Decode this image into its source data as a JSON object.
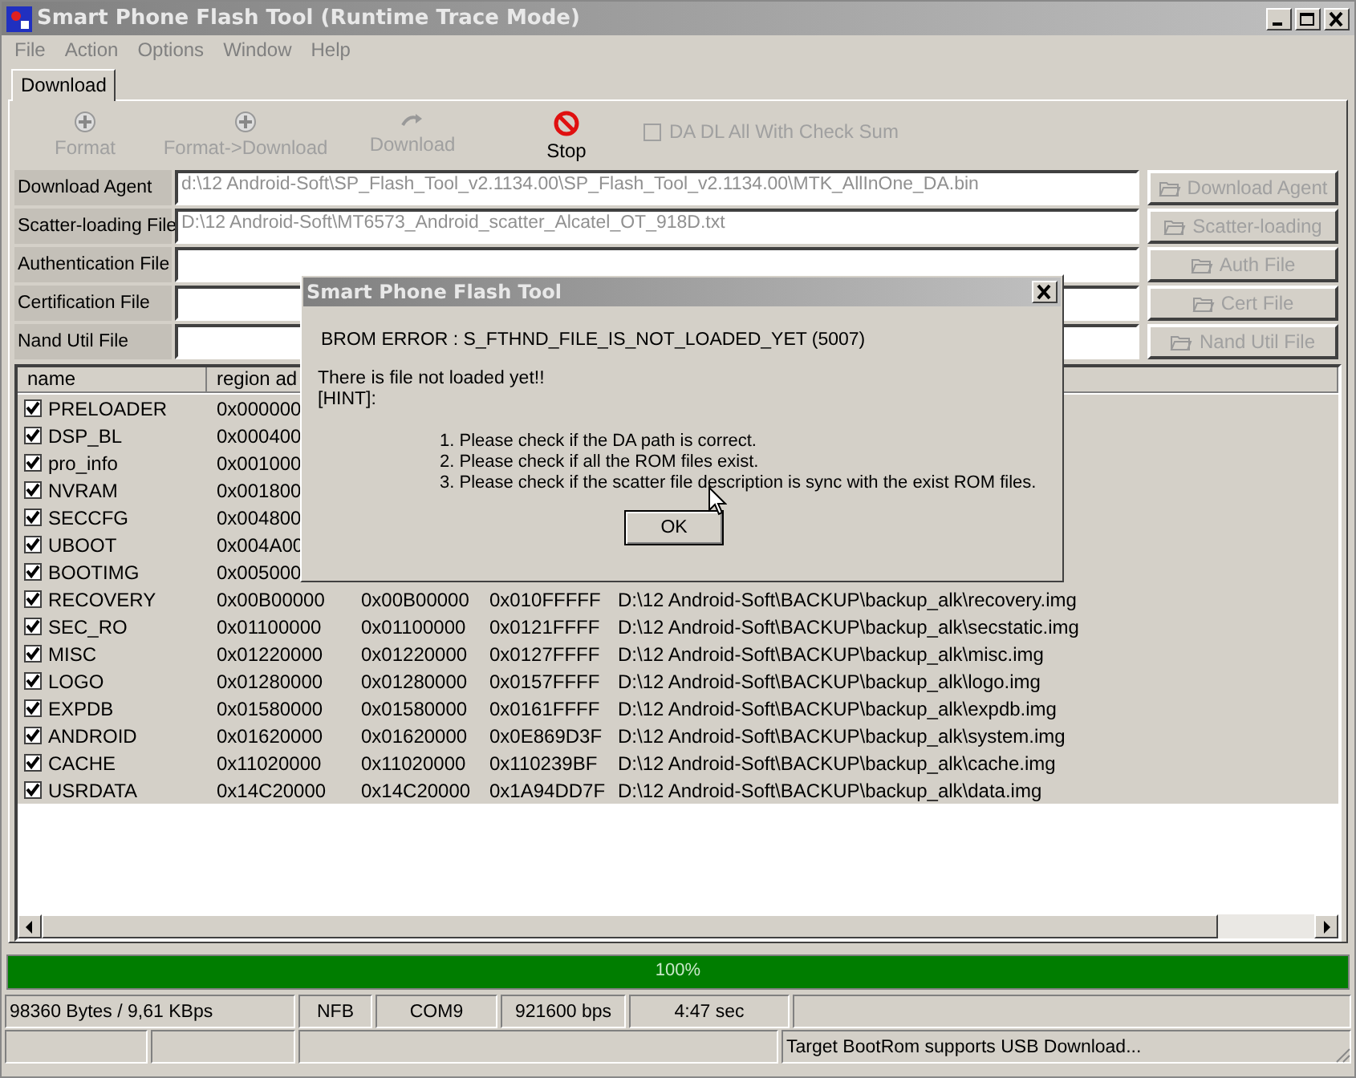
{
  "window": {
    "title": "Smart Phone Flash Tool (Runtime Trace Mode)"
  },
  "menu": [
    "File",
    "Action",
    "Options",
    "Window",
    "Help"
  ],
  "tabs": [
    {
      "label": "Download",
      "selected": true
    }
  ],
  "toolbar": [
    {
      "label": "Format",
      "kind": "format",
      "disabled": true
    },
    {
      "label": "Format->Download",
      "kind": "format",
      "disabled": true
    },
    {
      "label": "Download",
      "kind": "download",
      "disabled": true
    },
    {
      "label": "Stop",
      "kind": "stop",
      "disabled": false
    }
  ],
  "checksum_option": {
    "label": "DA DL All With Check Sum",
    "checked": false,
    "disabled": true
  },
  "files": [
    {
      "label": "Download Agent",
      "value": "d:\\12 Android-Soft\\SP_Flash_Tool_v2.1134.00\\SP_Flash_Tool_v2.1134.00\\MTK_AllInOne_DA.bin",
      "button": "Download Agent"
    },
    {
      "label": "Scatter-loading File",
      "value": "D:\\12 Android-Soft\\MT6573_Android_scatter_Alcatel_OT_918D.txt",
      "button": "Scatter-loading"
    },
    {
      "label": "Authentication File",
      "button": "Auth File"
    },
    {
      "label": "Certification File",
      "button": "Cert File"
    },
    {
      "label": "Nand Util File",
      "button": "Nand Util File"
    }
  ],
  "table": {
    "columns": [
      "name",
      "region ad"
    ],
    "rows": [
      {
        "checked": true,
        "cells": [
          "PRELOADER",
          "0x000000"
        ]
      },
      {
        "checked": true,
        "cells": [
          "DSP_BL",
          "0x000400"
        ]
      },
      {
        "checked": true,
        "cells": [
          "pro_info",
          "0x001000"
        ]
      },
      {
        "checked": true,
        "cells": [
          "NVRAM",
          "0x001800"
        ]
      },
      {
        "checked": true,
        "cells": [
          "SECCFG",
          "0x004800"
        ]
      },
      {
        "checked": true,
        "cells": [
          "UBOOT",
          "0x004A00"
        ]
      },
      {
        "checked": true,
        "cells": [
          "BOOTIMG",
          "0x005000"
        ]
      },
      {
        "checked": true,
        "cells": [
          "RECOVERY",
          "0x00B00000",
          "0x00B00000",
          "0x010FFFFF",
          "D:\\12 Android-Soft\\BACKUP\\backup_alk\\recovery.img"
        ]
      },
      {
        "checked": true,
        "cells": [
          "SEC_RO",
          "0x01100000",
          "0x01100000",
          "0x0121FFFF",
          "D:\\12 Android-Soft\\BACKUP\\backup_alk\\secstatic.img"
        ]
      },
      {
        "checked": true,
        "cells": [
          "MISC",
          "0x01220000",
          "0x01220000",
          "0x0127FFFF",
          "D:\\12 Android-Soft\\BACKUP\\backup_alk\\misc.img"
        ]
      },
      {
        "checked": true,
        "cells": [
          "LOGO",
          "0x01280000",
          "0x01280000",
          "0x0157FFFF",
          "D:\\12 Android-Soft\\BACKUP\\backup_alk\\logo.img"
        ]
      },
      {
        "checked": true,
        "cells": [
          "EXPDB",
          "0x01580000",
          "0x01580000",
          "0x0161FFFF",
          "D:\\12 Android-Soft\\BACKUP\\backup_alk\\expdb.img"
        ]
      },
      {
        "checked": true,
        "cells": [
          "ANDROID",
          "0x01620000",
          "0x01620000",
          "0x0E869D3F",
          "D:\\12 Android-Soft\\BACKUP\\backup_alk\\system.img"
        ]
      },
      {
        "checked": true,
        "cells": [
          "CACHE",
          "0x11020000",
          "0x11020000",
          "0x110239BF",
          "D:\\12 Android-Soft\\BACKUP\\backup_alk\\cache.img"
        ]
      },
      {
        "checked": true,
        "cells": [
          "USRDATA",
          "0x14C20000",
          "0x14C20000",
          "0x1A94DD7F",
          "D:\\12 Android-Soft\\BACKUP\\backup_alk\\data.img"
        ]
      }
    ]
  },
  "progress": {
    "level": 1,
    "label": "100%"
  },
  "status_bar": {
    "row_1": [
      "98360 Bytes / 9,61 KBps",
      "NFB",
      "COM9",
      "921600 bps",
      "4:47 sec"
    ],
    "message": "Target BootRom supports USB Download..."
  },
  "dialog": {
    "title": "Smart Phone Flash Tool",
    "error": "BROM ERROR : S_FTHND_FILE_IS_NOT_LOADED_YET (5007)",
    "lines": [
      "There is file not loaded yet!!",
      "[HINT]:"
    ],
    "hints": [
      "1. Please check if the DA path is correct.",
      "2. Please check if all the ROM files exist.",
      "3. Please check if the scatter file description is sync with the exist ROM files."
    ],
    "button": "OK"
  }
}
